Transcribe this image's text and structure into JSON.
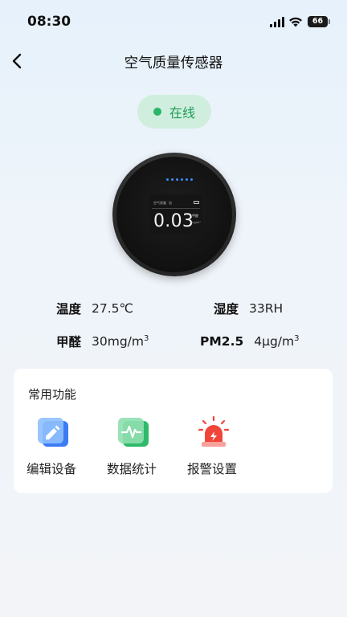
{
  "status_bar": {
    "time": "08:30",
    "battery": "66"
  },
  "nav": {
    "title": "空气质量传感器"
  },
  "device_status": {
    "label": "在线",
    "color": "#2ab56a"
  },
  "device_display": {
    "header_left": "空气质量",
    "header_mid": "包",
    "value": "0.03",
    "unit_top": "甲醛",
    "unit_bottom": "mg/m³"
  },
  "readings": [
    {
      "label": "温度",
      "value": "27.5℃"
    },
    {
      "label": "湿度",
      "value": "33RH"
    },
    {
      "label": "甲醛",
      "value": "30mg/m",
      "sup": "3"
    },
    {
      "label": "PM2.5",
      "value": "4μg/m",
      "sup": "3"
    }
  ],
  "functions": {
    "title": "常用功能",
    "items": [
      {
        "label": "编辑设备",
        "icon": "edit-device-icon"
      },
      {
        "label": "数据统计",
        "icon": "data-statistics-icon"
      },
      {
        "label": "报警设置",
        "icon": "alarm-settings-icon"
      }
    ]
  },
  "colors": {
    "accent_blue": "#3b7cf5",
    "accent_green": "#2fba6a",
    "accent_red": "#f0453a",
    "badge_bg": "#cfeedd"
  }
}
